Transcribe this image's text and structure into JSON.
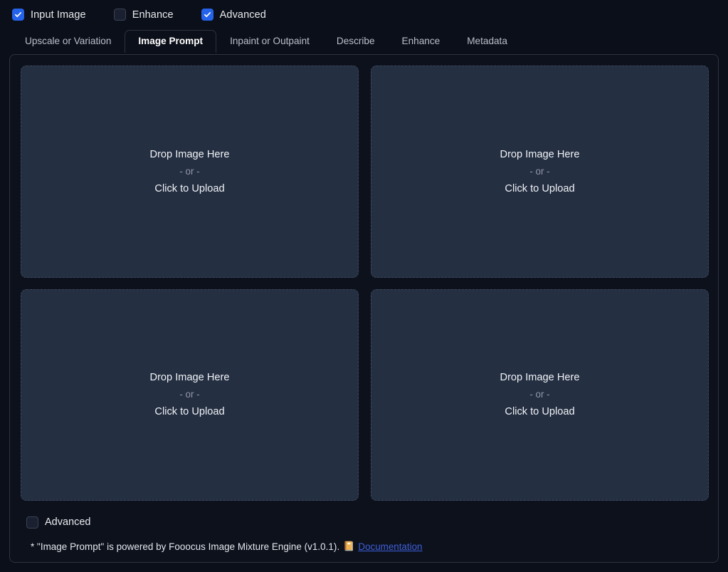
{
  "toggles": [
    {
      "label": "Input Image",
      "checked": true,
      "name": "input-image"
    },
    {
      "label": "Enhance",
      "checked": false,
      "name": "enhance"
    },
    {
      "label": "Advanced",
      "checked": true,
      "name": "advanced"
    }
  ],
  "tabs": [
    {
      "label": "Upscale or Variation",
      "active": false
    },
    {
      "label": "Image Prompt",
      "active": true
    },
    {
      "label": "Inpaint or Outpaint",
      "active": false
    },
    {
      "label": "Describe",
      "active": false
    },
    {
      "label": "Enhance",
      "active": false
    },
    {
      "label": "Metadata",
      "active": false
    }
  ],
  "dropzone": {
    "title": "Drop Image Here",
    "or": "- or -",
    "click": "Click to Upload",
    "count": 4
  },
  "advanced_bottom": {
    "label": "Advanced",
    "checked": false
  },
  "footer": {
    "note": "* \"Image Prompt\" is powered by Fooocus Image Mixture Engine (v1.0.1). ",
    "book_icon": "📔",
    "link": "Documentation"
  },
  "colors": {
    "page_bg": "#0b0f19",
    "panel_bg": "#0d111c",
    "panel_border": "#2b3340",
    "dropzone_bg": "#242f42",
    "dropzone_border": "#3b475c",
    "checkbox_on": "#2563eb",
    "link": "#3d5fd9",
    "text": "#e9eaee",
    "muted_text": "#9099a8"
  }
}
